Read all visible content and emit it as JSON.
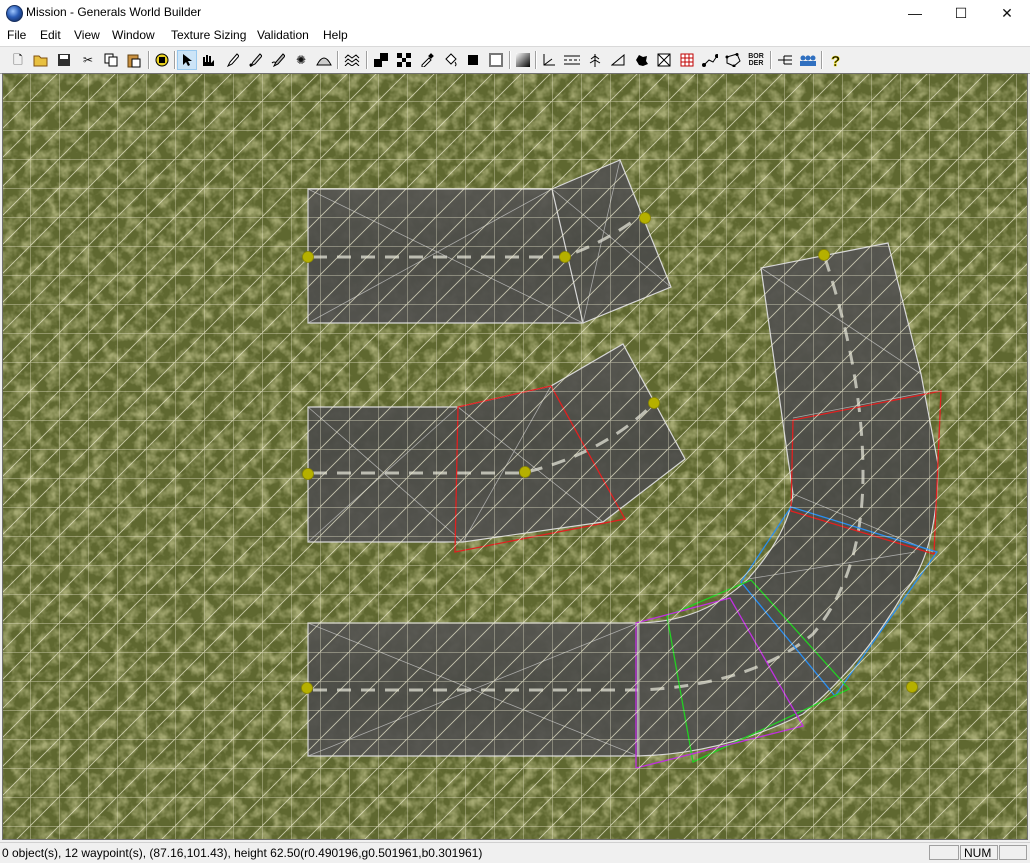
{
  "window": {
    "title": "Mission - Generals World Builder",
    "controls": {
      "minimize": "—",
      "maximize": "☐",
      "close": "✕"
    }
  },
  "menu": [
    "File",
    "Edit",
    "View",
    "Window",
    "Texture Sizing",
    "Validation",
    "Help"
  ],
  "toolbar": {
    "icons": [
      "new-file-icon",
      "open-file-icon",
      "save-icon",
      "cut-icon",
      "copy-icon",
      "paste-icon",
      "map-view-icon",
      "pointer-icon",
      "hand-select-icon",
      "brush-icon",
      "feather-brush-icon",
      "smooth-brush-icon",
      "spray-icon",
      "mound-icon",
      "layers-icon",
      "tile-fill-icon",
      "checker-icon",
      "eyedropper-icon",
      "bucket-icon",
      "black-square-icon",
      "white-square-icon",
      "gradient-icon",
      "axis-icon",
      "road-icon",
      "tree-icon",
      "ramp-icon",
      "blob-icon",
      "grid-icon",
      "fence-icon",
      "waypoint-icon",
      "polygon-icon",
      "border-icon",
      "script-icon",
      "team-icon",
      "help-icon"
    ],
    "border_label": "BOR DER"
  },
  "status": {
    "text": "0 object(s), 12 waypoint(s), (87.16,101.43), height 62.50(r0.490196,g0.501961,b0.301961)",
    "num": "NUM"
  },
  "scene": {
    "waypoint_count": 12,
    "colors": {
      "grass": "#626a2c",
      "road": "#4a4a4a",
      "grid": "#e8e8d0",
      "waypoint": "#b8b200",
      "selection_red": "#e02020",
      "selection_blue": "#2a8ef0",
      "selection_green": "#22d022",
      "selection_magenta": "#c030e0"
    }
  }
}
